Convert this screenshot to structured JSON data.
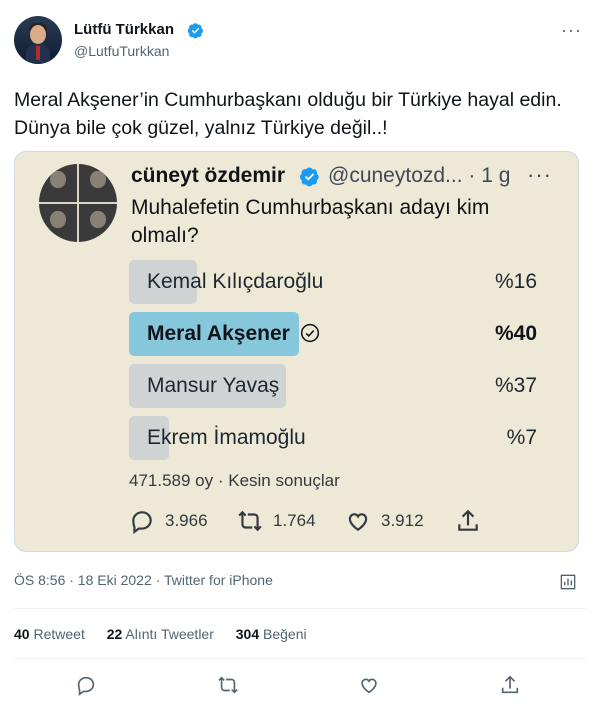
{
  "author": {
    "name": "Lütfü Türkkan",
    "handle": "@LutfuTurkkan"
  },
  "tweet": {
    "text": "Meral Akşener’in Cumhurbaşkanı olduğu bir Türkiye hayal edin. Dünya bile çok güzel, yalnız Türkiye değil..!",
    "timestamp": "ÖS 8:56 · 18 Eki 2022 · Twitter for iPhone"
  },
  "quoted": {
    "name": "cüneyt özdemir",
    "handle": "@cuneytozd...",
    "time": "· 1 g",
    "question": "Muhalefetin Cumhurbaşkanı adayı kim olmalı?",
    "options": [
      {
        "label": "Kemal Kılıçdaroğlu",
        "percent_text": "%16",
        "percent": 16,
        "winner": false
      },
      {
        "label": "Meral Akşener",
        "percent_text": "%40",
        "percent": 40,
        "winner": true
      },
      {
        "label": "Mansur Yavaş",
        "percent_text": "%37",
        "percent": 37,
        "winner": false
      },
      {
        "label": "Ekrem İmamoğlu",
        "percent_text": "%7",
        "percent": 7,
        "winner": false
      }
    ],
    "votes": "471.589 oy · Kesin sonuçlar",
    "replies": "3.966",
    "retweets": "1.764",
    "likes": "3.912"
  },
  "stats": {
    "retweet_count": "40",
    "retweet_label": "Retweet",
    "quote_count": "22",
    "quote_label": "Alıntı Tweetler",
    "like_count": "304",
    "like_label": "Beğeni"
  },
  "colors": {
    "accent": "#1d9bf0",
    "winner_bar": "#87c7dc",
    "bar": "#cfd3d4",
    "card_bg": "#eee8d6"
  },
  "icons": [
    "verified-badge-icon",
    "more-icon",
    "reply-icon",
    "retweet-icon",
    "like-icon",
    "share-icon",
    "check-circle-icon",
    "analytics-icon"
  ]
}
